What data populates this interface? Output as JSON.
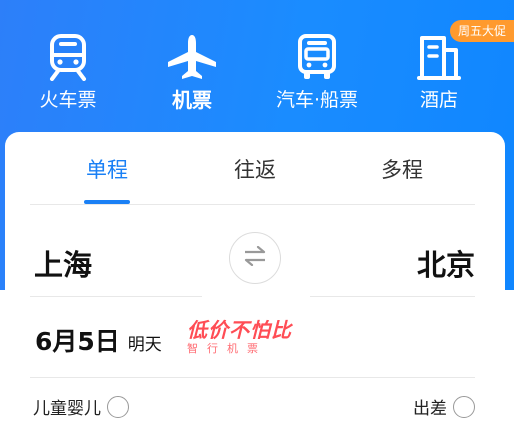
{
  "nav": {
    "items": [
      {
        "label": "火车票",
        "icon": "train-icon",
        "active": false
      },
      {
        "label": "机票",
        "icon": "airplane-icon",
        "active": true
      },
      {
        "label": "汽车·船票",
        "icon": "bus-icon",
        "active": false
      },
      {
        "label": "酒店",
        "icon": "hotel-icon",
        "active": false
      }
    ],
    "promo_badge": "周五大促"
  },
  "tabs": [
    {
      "label": "单程",
      "active": true
    },
    {
      "label": "往返",
      "active": false
    },
    {
      "label": "多程",
      "active": false
    }
  ],
  "route": {
    "from": "上海",
    "to": "北京",
    "swap_icon": "swap-icon"
  },
  "date": {
    "value": "6月5日",
    "relative": "明天"
  },
  "promo": {
    "title": "低价不怕比",
    "subtitle": "智行机票"
  },
  "options": {
    "child_infant": "儿童婴儿",
    "business_trip": "出差"
  },
  "colors": {
    "brand_blue": "#1a80f5",
    "header_blue": "#1a8cff",
    "promo_orange": "#ff9a2e",
    "promo_red": "#ff4d55"
  }
}
